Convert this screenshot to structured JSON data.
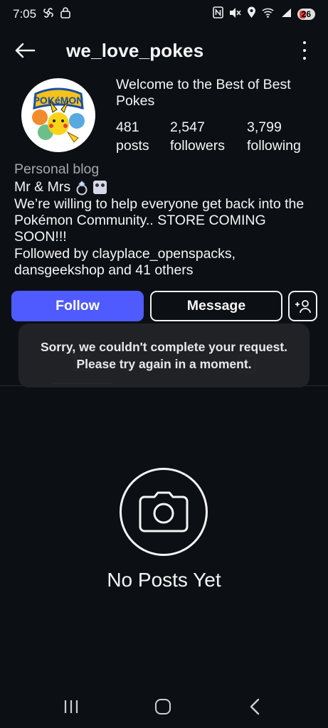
{
  "status_bar": {
    "time": "7:05",
    "battery": "26"
  },
  "header": {
    "username": "we_love_pokes"
  },
  "profile": {
    "avatar_alt": "Pokémon logo with Charmander, Pikachu, Squirtle",
    "name": "Welcome to the Best of Best Pokes",
    "stats": {
      "posts_count": "481",
      "posts_label": "posts",
      "followers_count": "2,547",
      "followers_label": "followers",
      "following_count": "3,799",
      "following_label": "following"
    },
    "category": "Personal blog",
    "bio_line1": "Mr & Mrs",
    "bio_line2": "We’re willing to help everyone get back into the Pokémon Community.. STORE COMING SOON!!!",
    "followed_by": "Followed by clayplace_openspacks, dansgeekshop and 41 others"
  },
  "actions": {
    "follow_label": "Follow",
    "message_label": "Message"
  },
  "toast": {
    "message": "Sorry, we couldn't complete your request. Please try again in a moment."
  },
  "empty_state": {
    "title": "No Posts Yet"
  },
  "icons": {
    "back": "arrow-left-icon",
    "more": "more-vertical-icon",
    "suggest": "add-person-icon",
    "grid": "grid-icon",
    "tagged": "tagged-icon",
    "camera": "camera-icon"
  },
  "colors": {
    "background": "#0c1014",
    "follow_button": "#4f5bff",
    "toast": "#212326",
    "muted_text": "#a8a8a8"
  }
}
